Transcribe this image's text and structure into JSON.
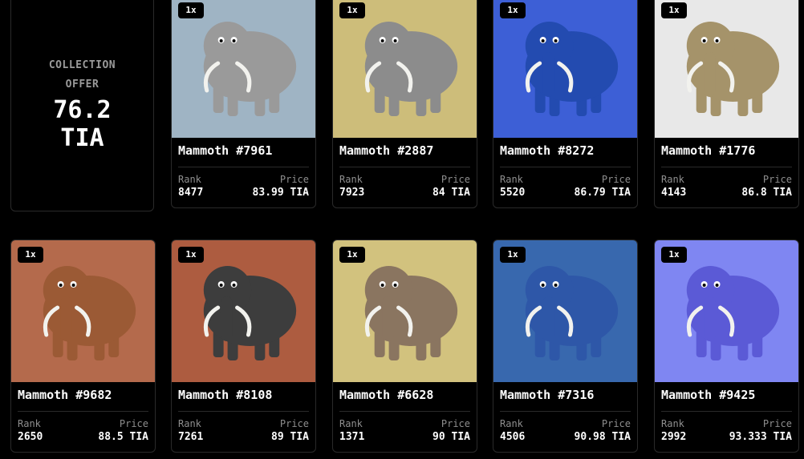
{
  "offer": {
    "label_line1": "COLLECTION",
    "label_line2": "OFFER",
    "amount": "76.2",
    "currency": "TIA"
  },
  "labels": {
    "rank": "Rank",
    "price": "Price"
  },
  "cards": [
    {
      "name": "Mammoth #7961",
      "quantity": "1x",
      "rank": "8477",
      "price": "83.99 TIA",
      "bg": "#9fb4c4",
      "body": "#9a9a9a"
    },
    {
      "name": "Mammoth #2887",
      "quantity": "1x",
      "rank": "7923",
      "price": "84 TIA",
      "bg": "#cdbd7a",
      "body": "#8c8c8c"
    },
    {
      "name": "Mammoth #8272",
      "quantity": "1x",
      "rank": "5520",
      "price": "86.79 TIA",
      "bg": "#3d5fd6",
      "body": "#234bb0"
    },
    {
      "name": "Mammoth #1776",
      "quantity": "1x",
      "rank": "4143",
      "price": "86.8 TIA",
      "bg": "#e8e8e8",
      "body": "#a5936a"
    },
    {
      "name": "Mammoth #9682",
      "quantity": "1x",
      "rank": "2650",
      "price": "88.5 TIA",
      "bg": "#b46a4c",
      "body": "#9b5a35"
    },
    {
      "name": "Mammoth #8108",
      "quantity": "1x",
      "rank": "7261",
      "price": "89 TIA",
      "bg": "#ad5c40",
      "body": "#3d3d3d"
    },
    {
      "name": "Mammoth #6628",
      "quantity": "1x",
      "rank": "1371",
      "price": "90 TIA",
      "bg": "#d2c27e",
      "body": "#8a7560"
    },
    {
      "name": "Mammoth #7316",
      "quantity": "1x",
      "rank": "4506",
      "price": "90.98 TIA",
      "bg": "#3868ae",
      "body": "#2e57a8"
    },
    {
      "name": "Mammoth #9425",
      "quantity": "1x",
      "rank": "2992",
      "price": "93.333 TIA",
      "bg": "#7f86f2",
      "body": "#5b5ad6"
    }
  ]
}
